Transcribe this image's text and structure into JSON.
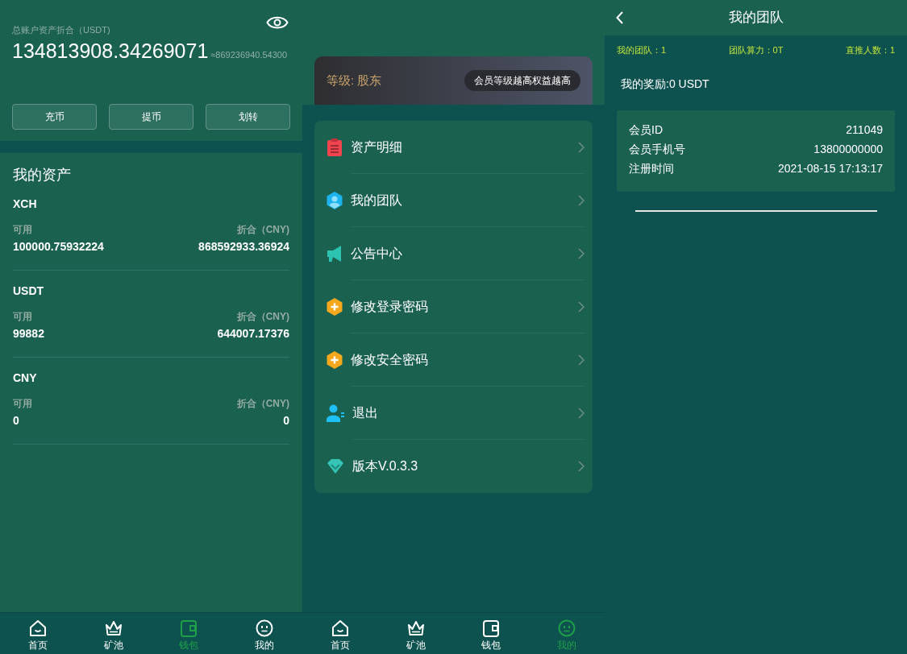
{
  "wallet_screen": {
    "header": {
      "label": "总账户资产折合（USDT)",
      "total": "134813908.34269071",
      "approx": "≈869236940.54300"
    },
    "actions": [
      "充币",
      "提币",
      "划转"
    ],
    "assets_title": "我的资产",
    "assets": [
      {
        "name": "XCH",
        "available_label": "可用",
        "available": "100000.75932224",
        "value_label": "折合（CNY)",
        "value": "868592933.36924"
      },
      {
        "name": "USDT",
        "available_label": "可用",
        "available": "99882",
        "value_label": "折合（CNY)",
        "value": "644007.17376"
      },
      {
        "name": "CNY",
        "available_label": "可用",
        "available": "0",
        "value_label": "折合（CNY)",
        "value": "0"
      }
    ],
    "tab_bar": [
      {
        "label": "首页",
        "selected": false
      },
      {
        "label": "矿池",
        "selected": false
      },
      {
        "label": "钱包",
        "selected": true
      },
      {
        "label": "我的",
        "selected": false
      }
    ]
  },
  "profile_screen": {
    "level": {
      "label": "等级: 股东",
      "tip": "会员等级越高权益越高"
    },
    "menu": [
      "资产明细",
      "我的团队",
      "公告中心",
      "修改登录密码",
      "修改安全密码",
      "退出",
      "版本V.0.3.3"
    ],
    "tab_bar": [
      {
        "label": "首页",
        "selected": false
      },
      {
        "label": "矿池",
        "selected": false
      },
      {
        "label": "钱包",
        "selected": false
      },
      {
        "label": "我的",
        "selected": true
      }
    ]
  },
  "team_screen": {
    "title": "我的团队",
    "stats": [
      "我的团队：1",
      "团队算力：0T",
      "直推人数：1"
    ],
    "reward": "我的奖励:0 USDT",
    "info": [
      {
        "label": "会员ID",
        "value": "211049"
      },
      {
        "label": "会员手机号",
        "value": "13800000000"
      },
      {
        "label": "注册时间",
        "value": "2021-08-15 17:13:17"
      }
    ]
  }
}
